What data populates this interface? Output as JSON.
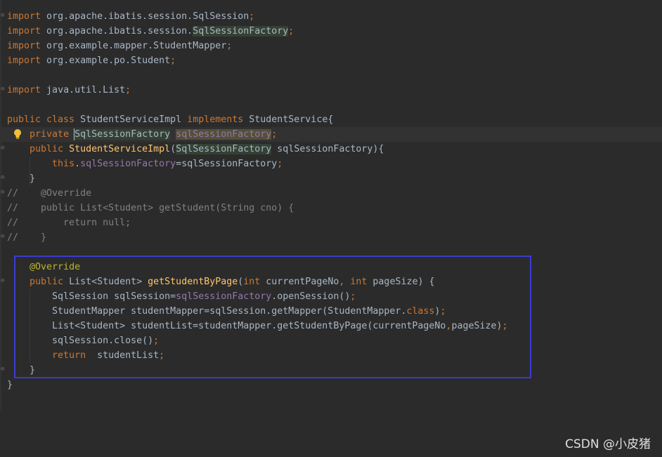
{
  "editor": {
    "lines": [
      [
        {
          "t": "import",
          "c": "kw"
        },
        {
          "t": " org.apache.ibatis.session.SqlSession",
          "c": "txt"
        },
        {
          "t": ";",
          "c": "kw"
        }
      ],
      [
        {
          "t": "import",
          "c": "kw"
        },
        {
          "t": " org.apache.ibatis.session.",
          "c": "txt"
        },
        {
          "t": "SqlSessionFactory",
          "c": "txt usage-bg"
        },
        {
          "t": ";",
          "c": "kw"
        }
      ],
      [
        {
          "t": "import",
          "c": "kw"
        },
        {
          "t": " org.example.mapper.StudentMapper",
          "c": "txt"
        },
        {
          "t": ";",
          "c": "kw"
        }
      ],
      [
        {
          "t": "import",
          "c": "kw"
        },
        {
          "t": " org.example.po.Student",
          "c": "txt"
        },
        {
          "t": ";",
          "c": "kw"
        }
      ],
      [],
      [
        {
          "t": "import",
          "c": "kw"
        },
        {
          "t": " java.util.List",
          "c": "txt"
        },
        {
          "t": ";",
          "c": "kw"
        }
      ],
      [],
      [
        {
          "t": "public class ",
          "c": "kw"
        },
        {
          "t": "StudentServiceImpl ",
          "c": "txt"
        },
        {
          "t": "implements ",
          "c": "kw"
        },
        {
          "t": "StudentService{",
          "c": "txt"
        }
      ],
      [
        {
          "t": "    ",
          "c": "txt"
        },
        {
          "t": "private ",
          "c": "kw"
        },
        {
          "t": "SqlSessionFactory",
          "c": "txt usage-bg"
        },
        {
          "t": " ",
          "c": "txt"
        },
        {
          "t": "sqlSessionFactory",
          "c": "field warn-bg"
        },
        {
          "t": ";",
          "c": "kw"
        }
      ],
      [
        {
          "t": "    ",
          "c": "txt"
        },
        {
          "t": "public ",
          "c": "kw"
        },
        {
          "t": "StudentServiceImpl",
          "c": "method-decl"
        },
        {
          "t": "(",
          "c": "txt"
        },
        {
          "t": "SqlSessionFactory",
          "c": "txt usage-bg"
        },
        {
          "t": " sqlSessionFactory){",
          "c": "txt"
        }
      ],
      [
        {
          "t": "        ",
          "c": "txt"
        },
        {
          "t": "this",
          "c": "kw"
        },
        {
          "t": ".",
          "c": "txt"
        },
        {
          "t": "sqlSessionFactory",
          "c": "field"
        },
        {
          "t": "=sqlSessionFactory",
          "c": "txt"
        },
        {
          "t": ";",
          "c": "kw"
        }
      ],
      [
        {
          "t": "    }",
          "c": "txt"
        }
      ],
      [
        {
          "t": "//    @Override",
          "c": "comment"
        }
      ],
      [
        {
          "t": "//    public List<Student> getStudent(String cno) {",
          "c": "comment"
        }
      ],
      [
        {
          "t": "//        return null;",
          "c": "comment"
        }
      ],
      [
        {
          "t": "//    }",
          "c": "comment"
        }
      ],
      [],
      [
        {
          "t": "    ",
          "c": "txt"
        },
        {
          "t": "@Override",
          "c": "annotation"
        }
      ],
      [
        {
          "t": "    ",
          "c": "txt"
        },
        {
          "t": "public ",
          "c": "kw"
        },
        {
          "t": "List<Student> ",
          "c": "txt"
        },
        {
          "t": "getStudentByPage",
          "c": "method-decl"
        },
        {
          "t": "(",
          "c": "txt"
        },
        {
          "t": "int ",
          "c": "kw"
        },
        {
          "t": "currentPageNo",
          "c": "txt"
        },
        {
          "t": ", ",
          "c": "kw"
        },
        {
          "t": "int ",
          "c": "kw"
        },
        {
          "t": "pageSize) {",
          "c": "txt"
        }
      ],
      [
        {
          "t": "        SqlSession sqlSession=",
          "c": "txt"
        },
        {
          "t": "sqlSessionFactory",
          "c": "field"
        },
        {
          "t": ".openSession()",
          "c": "txt"
        },
        {
          "t": ";",
          "c": "kw"
        }
      ],
      [
        {
          "t": "        StudentMapper studentMapper=sqlSession.getMapper(StudentMapper.",
          "c": "txt"
        },
        {
          "t": "class",
          "c": "kw"
        },
        {
          "t": ")",
          "c": "txt"
        },
        {
          "t": ";",
          "c": "kw"
        }
      ],
      [
        {
          "t": "        List<Student> studentList=studentMapper.getStudentByPage(currentPageNo",
          "c": "txt"
        },
        {
          "t": ",",
          "c": "kw"
        },
        {
          "t": "pageSize)",
          "c": "txt"
        },
        {
          "t": ";",
          "c": "kw"
        }
      ],
      [
        {
          "t": "        sqlSession.close()",
          "c": "txt"
        },
        {
          "t": ";",
          "c": "kw"
        }
      ],
      [
        {
          "t": "        ",
          "c": "txt"
        },
        {
          "t": "return  ",
          "c": "kw"
        },
        {
          "t": "studentList",
          "c": "txt"
        },
        {
          "t": ";",
          "c": "kw"
        }
      ],
      [
        {
          "t": "    }",
          "c": "txt"
        }
      ],
      [
        {
          "t": "}",
          "c": "txt"
        }
      ]
    ]
  },
  "watermark": "CSDN @小皮猪",
  "colors": {
    "background": "#2b2b2b",
    "keyword": "#cc7832",
    "identifier": "#a9b7c6",
    "field": "#9876aa",
    "method_declaration": "#ffc66d",
    "annotation": "#bbb529",
    "comment": "#808080",
    "highlight_frame": "#3b3bd1"
  },
  "icons": {
    "intention_bulb": "lightbulb-icon"
  }
}
